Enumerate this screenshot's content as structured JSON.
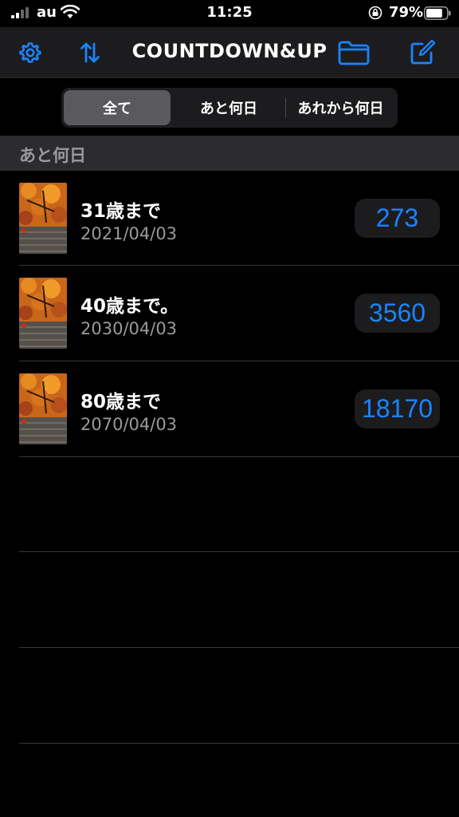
{
  "status_bar": {
    "carrier": "au",
    "time": "11:25",
    "battery_percent": "79%",
    "battery_level": 0.79
  },
  "nav": {
    "title": "COUNTDOWN&UP",
    "accent_color": "#1a84ff",
    "icons": [
      "gear-icon",
      "sort-arrows-icon",
      "folder-icon",
      "compose-icon"
    ]
  },
  "segmented": {
    "options": [
      "全て",
      "あと何日",
      "あれから何日"
    ],
    "selected_index": 0
  },
  "section": {
    "title": "あと何日"
  },
  "items": [
    {
      "name": "31歳まで",
      "date": "2021/04/03",
      "days": "273"
    },
    {
      "name": "40歳まで。",
      "date": "2030/04/03",
      "days": "3560"
    },
    {
      "name": "80歳まで",
      "date": "2070/04/03",
      "days": "18170"
    }
  ]
}
